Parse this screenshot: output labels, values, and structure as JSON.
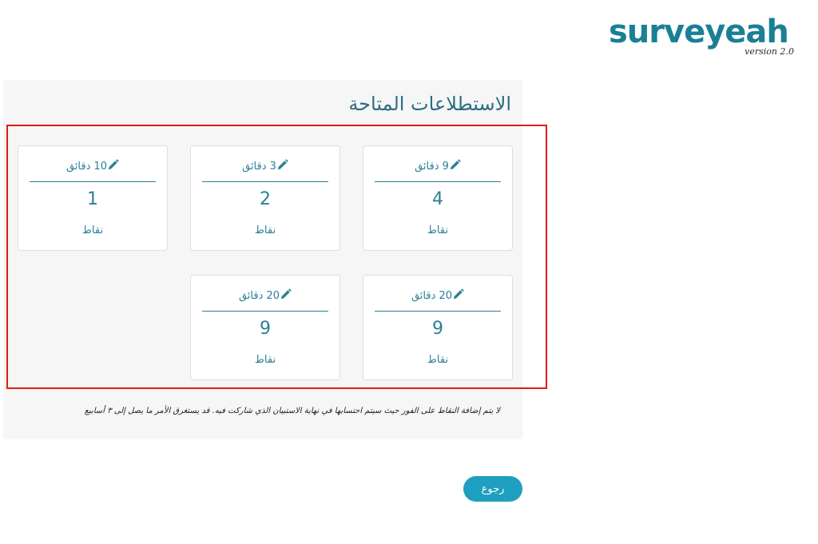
{
  "logo": {
    "name": "surveyeah",
    "version": "version 2.0",
    "color": "#1b7f95"
  },
  "panel": {
    "title": "الاستطلاعات المتاحة",
    "surveys": [
      {
        "duration": "9 دقائق",
        "points": "4",
        "unit": "نقاط"
      },
      {
        "duration": "3 دقائق",
        "points": "2",
        "unit": "نقاط"
      },
      {
        "duration": "10 دقائق",
        "points": "1",
        "unit": "نقاط"
      },
      {
        "duration": "20 دقائق",
        "points": "9",
        "unit": "نقاط"
      },
      {
        "duration": "20 دقائق",
        "points": "9",
        "unit": "نقاط"
      }
    ],
    "note": "لا يتم إضافة النقاط على الفور حيث سيتم احتسابها في نهاية الاستبيان الذي شاركت فيه. قد يستغرق الأمر ما يصل إلى ٣ أسابيع"
  },
  "back_button": {
    "label": "رجوع"
  },
  "colors": {
    "accent": "#2b7f95",
    "button": "#1f9fbf",
    "highlight": "#e11a1a"
  },
  "icons": [
    "pencil-icon"
  ]
}
